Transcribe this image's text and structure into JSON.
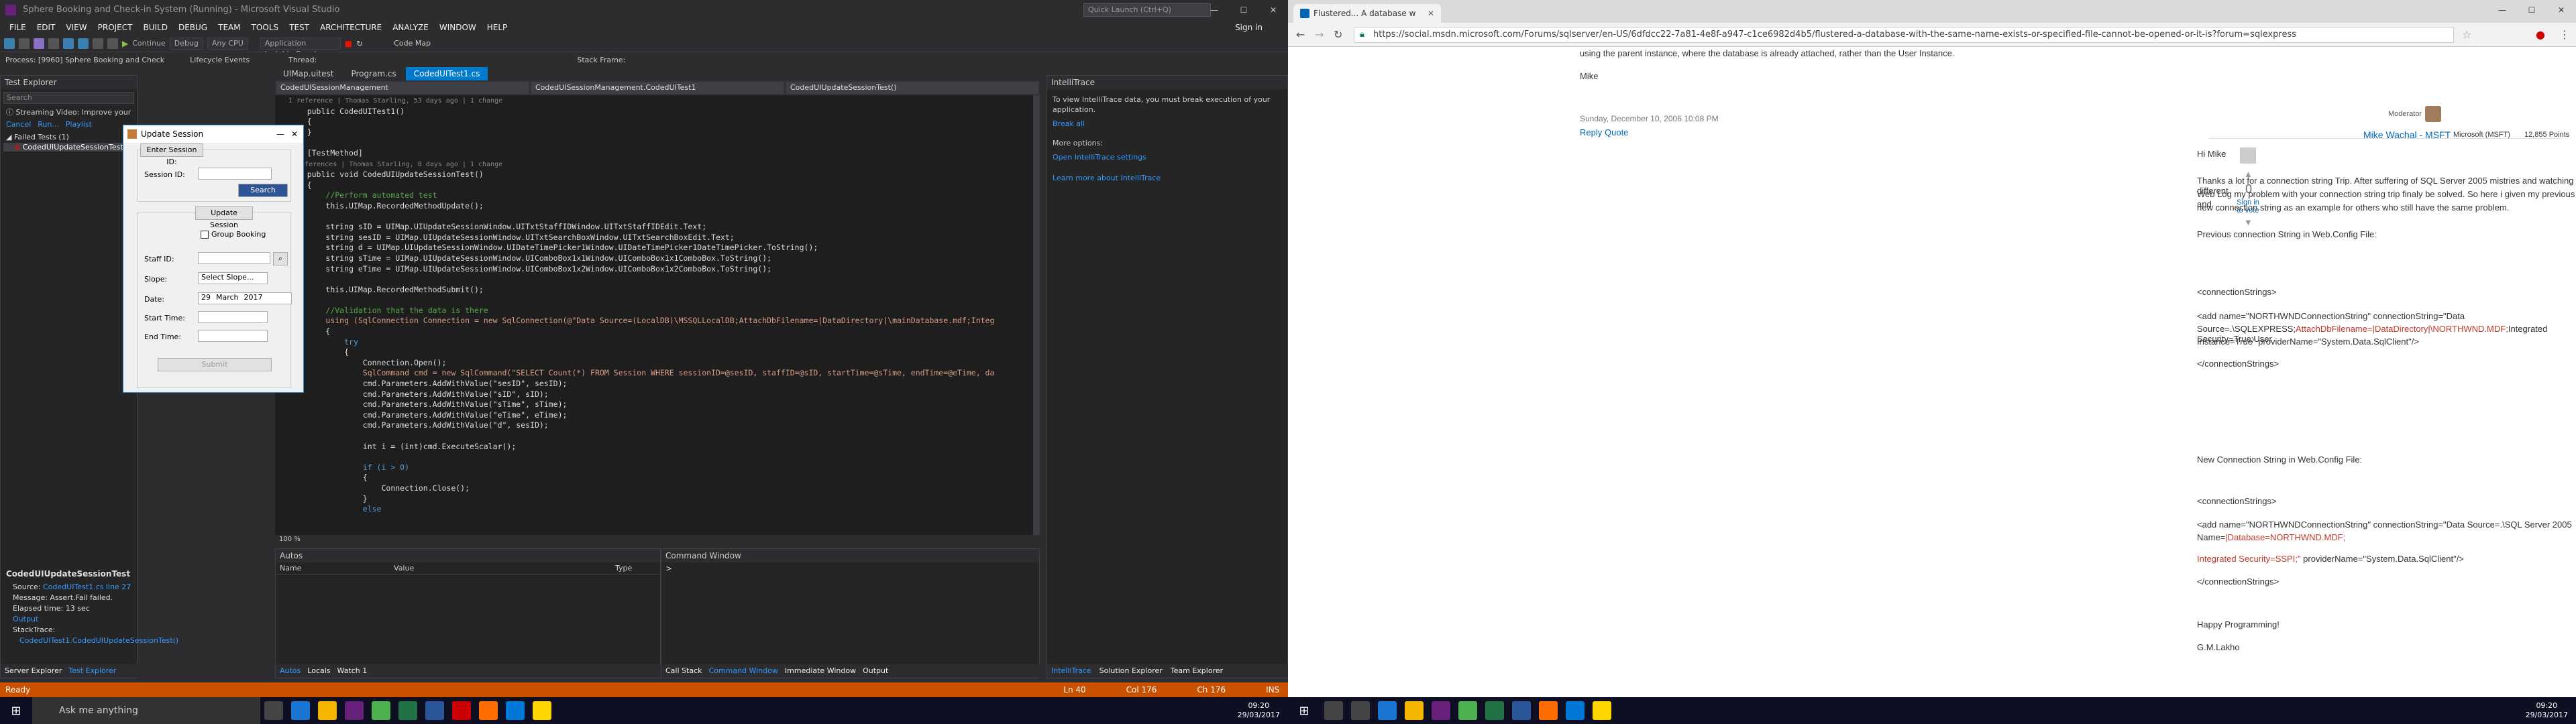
{
  "vs": {
    "title": "Sphere Booking and Check-in System (Running) - Microsoft Visual Studio",
    "quick_launch": "Quick Launch (Ctrl+Q)",
    "signin": "Sign in",
    "menu": [
      "FILE",
      "EDIT",
      "VIEW",
      "PROJECT",
      "BUILD",
      "DEBUG",
      "TEAM",
      "TOOLS",
      "TEST",
      "ARCHITECTURE",
      "ANALYZE",
      "WINDOW",
      "HELP"
    ],
    "toolbar": {
      "continue": "Continue",
      "dd_config": "Debug",
      "dd_platform": "Any CPU",
      "insights": "Application Insights Events",
      "codemap": "Code Map"
    },
    "process": "Process: [9960] Sphere Booking and Check",
    "lifecycle": "Lifecycle Events",
    "thread": "Thread:",
    "stackframe": "Stack Frame:",
    "test_explorer": {
      "title": "Test Explorer",
      "search": "Search",
      "streaming": "Streaming Video: Improve your",
      "actions": [
        "Cancel",
        "Run...",
        "Playlist"
      ],
      "failed": "Failed Tests (1)",
      "test_name": "CodedUIUpdateSessionTest",
      "detail_title": "CodedUIUpdateSessionTest",
      "source_label": "Source:",
      "source": "CodedUITest1.cs line 27",
      "message": "Message: Assert.Fail failed.",
      "elapsed": "Elapsed time: 13 sec",
      "output": "Output",
      "stacktrace": "StackTrace:",
      "stack1": "CodedUITest1.CodedUIUpdateSessionTest()",
      "tabs": [
        "Server Explorer",
        "Test Explorer"
      ]
    },
    "editor_tabs": [
      "UIMap.uitest",
      "Program.cs",
      "CodedUITest1.cs"
    ],
    "nav": [
      "CodedUISessionManagement",
      "CodedUISessionManagement.CodedUITest1",
      "CodedUIUpdateSessionTest()"
    ],
    "zoom": "100 %",
    "intellitrace": {
      "title": "IntelliTrace",
      "msg": "To view IntelliTrace data, you must break execution of your application.",
      "break_all": "Break all",
      "more": "More options:",
      "open_settings": "Open IntelliTrace settings",
      "learn": "Learn more about IntelliTrace",
      "tabs": [
        "IntelliTrace",
        "Solution Explorer",
        "Team Explorer"
      ]
    },
    "autos": {
      "title": "Autos",
      "cols": [
        "Name",
        "Value",
        "Type"
      ],
      "tabs": [
        "Autos",
        "Locals",
        "Watch 1"
      ]
    },
    "command": {
      "title": "Command Window",
      "prompt": ">",
      "tabs": [
        "Call Stack",
        "Command Window",
        "Immediate Window",
        "Output"
      ]
    },
    "status": {
      "ready": "Ready",
      "ln": "Ln 40",
      "col": "Col 176",
      "ch": "Ch 176",
      "ins": "INS"
    },
    "dialog": {
      "title": "Update Session",
      "enter_id": "Enter Session ID:",
      "session_id": "Session ID:",
      "search": "Search",
      "update_session": "Update Session",
      "group_booking": "Group Booking",
      "staff_id": "Staff ID:",
      "slope": "Slope:",
      "slope_value": "Select Slope...",
      "date": "Date:",
      "date_day": "29",
      "date_month": "March",
      "date_year": "2017",
      "start": "Start Time:",
      "end": "End Time:",
      "submit": "Submit"
    }
  },
  "code": {
    "l1": "1 reference | Thomas Starling, 53 days ago | 1 change",
    "l2": "public CodedUITest1()",
    "l3": "{",
    "l4": "}",
    "l5": "[TestMethod]",
    "l6": "0 references | Thomas Starling, 8 days ago | 1 change",
    "l7": "public void CodedUIUpdateSessionTest()",
    "l8": "{",
    "c1": "//Perform automated test",
    "a1": "this.UIMap.RecordedMethodUpdate();",
    "a2": "string sID = UIMap.UIUpdateSessionWindow.UITxtStaffIDWindow.UITxtStaffIDEdit.Text;",
    "a3": "string sesID = UIMap.UIUpdateSessionWindow.UITxtSearchBoxWindow.UITxtSearchBoxEdit.Text;",
    "a4": "string d = UIMap.UIUpdateSessionWindow.UIDateTimePicker1Window.UIDateTimePicker1DateTimePicker.ToString();",
    "a5": "string sTime = UIMap.UIUpdateSessionWindow.UIComboBox1x1Window.UIComboBox1x1ComboBox.ToString();",
    "a6": "string eTime = UIMap.UIUpdateSessionWindow.UIComboBox1x2Window.UIComboBox1x2ComboBox.ToString();",
    "a7": "this.UIMap.RecordedMethodSubmit();",
    "c2": "//Validation that the data is there",
    "a8": "using (SqlConnection Connection = new SqlConnection(@\"Data Source=(LocalDB)\\MSSQLLocalDB;AttachDbFilename=|DataDirectory|\\mainDatabase.mdf;Integ",
    "a9": "{",
    "a10": "try",
    "a11": "{",
    "b1": "Connection.Open();",
    "b2": "SqlCommand cmd = new SqlCommand(\"SELECT Count(*) FROM Session WHERE sessionID=@sesID, staffID=@sID, startTime=@sTime, endTime=@eTime, da",
    "b3": "cmd.Parameters.AddWithValue(\"sesID\", sesID);",
    "b4": "cmd.Parameters.AddWithValue(\"sID\", sID);",
    "b5": "cmd.Parameters.AddWithValue(\"sTime\", sTime);",
    "b6": "cmd.Parameters.AddWithValue(\"eTime\", eTime);",
    "b7": "cmd.Parameters.AddWithValue(\"d\", sesID);",
    "b8": "int i = (int)cmd.ExecuteScalar();",
    "b9": "if (i > 0)",
    "b10": "{",
    "b11": "Connection.Close();",
    "b12": "}",
    "b13": "else"
  },
  "chrome": {
    "tab": "Flustered... A database w",
    "url": "https://social.msdn.microsoft.com/Forums/sqlserver/en-US/6dfdcc22-7a81-4e8f-a947-c1ce6982d4b5/flustered-a-database-with-the-same-name-exists-or-specified-file-cannot-be-opened-or-it-is?forum=sqlexpress",
    "p1": "using the parent instance, where the database is already attached, rather than the User Instance.",
    "mike": "Mike",
    "date": "Sunday, December 10, 2006 10:08 PM",
    "reply": "Reply",
    "quote": "Quote",
    "author": "Mike Wachal - MSFT",
    "company": "Microsoft (MSFT)",
    "moderator": "Moderator",
    "points": "12,855 Points",
    "vote_count": "0",
    "vote_text1": "Sign in",
    "vote_text2": "to vote",
    "hi": "Hi Mike",
    "body1": "Thanks a lot for a connection string Trip. After suffering of SQL Server 2005 mistries and watching different",
    "body2": "Web Log my problem with your connection string trip finaly be solved. So here i given my previous and",
    "body3": "new connection string as an example for others who still have the same problem.",
    "prev": "Previous connection String in Web.Config File:",
    "cs_open": "<connectionStrings>",
    "add1a": "<add name=\"NORTHWNDConnectionString\" connectionString=\"Data",
    "add1b_pre": "Source=.\\SQLEXPRESS;",
    "add1b_red": "AttachDbFilename=|DataDirectory|\\NORTHWND.MDF;",
    "add1b_post": "Integrated Security=True;User",
    "add1c": "Instance=True\" providerName=\"System.Data.SqlClient\"/>",
    "cs_close": "</connectionStrings>",
    "newcs": "New Connection String in Web.Config File:",
    "add2a": "<add name=\"NORTHWNDConnectionString\" connectionString=\"Data Source=.\\SQL Server 2005",
    "add2b_pre": "Name=",
    "add2b_red": "|Database=NORTHWND.MDF;",
    "add2c_red": "Integrated Security=SSPI;\"",
    "add2c_post": " providerName=\"System.Data.SqlClient\"/>",
    "happy": "Happy Programming!",
    "sig": "G.M.Lakho"
  },
  "taskbar": {
    "search": "Ask me anything",
    "time1": "09:20",
    "date1": "29/03/2017",
    "time2": "09:20",
    "date2": "29/03/2017"
  }
}
